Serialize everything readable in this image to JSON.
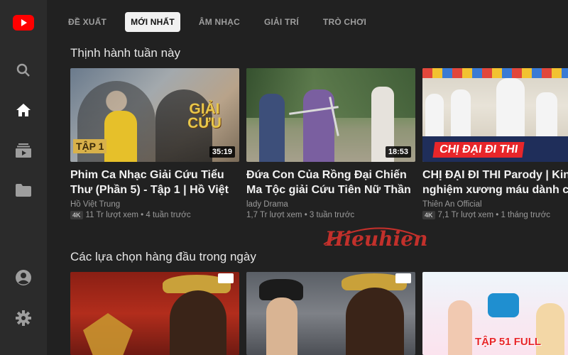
{
  "tabs": [
    {
      "label": "ĐỀ XUẤT",
      "active": false
    },
    {
      "label": "MỚI NHẤT",
      "active": true
    },
    {
      "label": "ÂM NHẠC",
      "active": false
    },
    {
      "label": "GIẢI TRÍ",
      "active": false
    },
    {
      "label": "TRÒ CHƠI",
      "active": false
    }
  ],
  "sections": {
    "trending_title": "Thịnh hành tuần này",
    "top_picks_title": "Các lựa chọn hàng đầu trong ngày"
  },
  "videos": [
    {
      "title": "Phim Ca Nhạc Giải Cứu Tiểu Thư (Phần 5) - Tập 1 | Hồ Việt",
      "channel": "Hồ Việt Trung",
      "badge": "4K",
      "stats": "11 Tr lượt xem • 4 tuần trước",
      "duration": "35:19",
      "thumb_text_1": "TẬP 1",
      "thumb_text_2": "GIẢI CỨU"
    },
    {
      "title": "Đứa Con Của Rồng Đại Chiến Ma Tộc giải Cứu Tiên Nữ Thần",
      "channel": "lady Drama",
      "badge": "",
      "stats": "1,7 Tr lượt xem • 3 tuần trước",
      "duration": "18:53"
    },
    {
      "title": "CHỊ ĐẠI ĐI THI Parody | Kinh nghiệm xương máu dành cho",
      "channel": "Thiên An Official",
      "badge": "4K",
      "stats": "7,1 Tr lượt xem • 1 tháng trước",
      "thumb_text_1": "CHỊ ĐẠI ĐI THI"
    }
  ],
  "row2": [
    {
      "thumb": "bao-cong-1"
    },
    {
      "thumb": "bao-cong-2"
    },
    {
      "thumb": "kids-show",
      "thumb_text": "TẬP 51 FULL"
    }
  ],
  "watermark": "Hieuhien",
  "colors": {
    "accent": "#ff0000",
    "background": "#212121",
    "sidebar": "#2b2b2b"
  },
  "icons": [
    "youtube-logo-icon",
    "search-icon",
    "home-icon",
    "subscriptions-icon",
    "library-icon",
    "account-icon",
    "settings-icon"
  ]
}
